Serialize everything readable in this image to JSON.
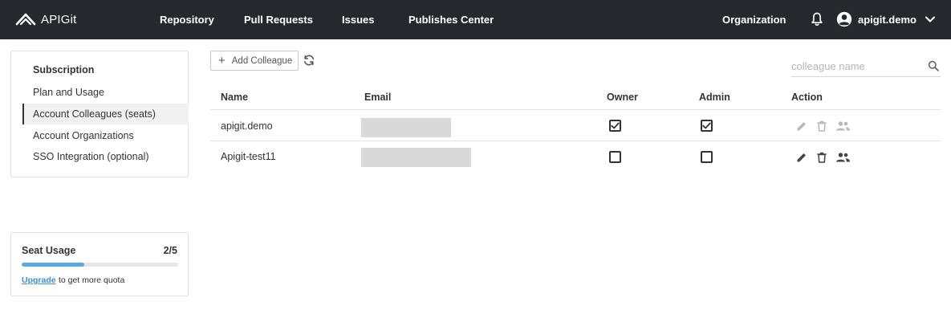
{
  "header": {
    "brand": "APIGit",
    "nav": [
      "Repository",
      "Pull Requests",
      "Issues",
      "Publishes Center"
    ],
    "org_link": "Organization",
    "user": "apigit.demo"
  },
  "sidebar": {
    "title": "Subscription",
    "items": [
      {
        "label": "Plan and Usage"
      },
      {
        "label": "Account Colleagues (seats)",
        "active": true
      },
      {
        "label": "Account Organizations"
      },
      {
        "label": "SSO Integration (optional)"
      }
    ]
  },
  "seat_usage": {
    "title": "Seat Usage",
    "count": "2/5",
    "used": 2,
    "total": 5,
    "upgrade_link": "Upgrade",
    "note": "to get more quota"
  },
  "toolbar": {
    "add_label": "Add Colleague",
    "search_placeholder": "colleague name"
  },
  "table": {
    "headers": {
      "name": "Name",
      "email": "Email",
      "owner": "Owner",
      "admin": "Admin",
      "action": "Action"
    },
    "rows": [
      {
        "name": "apigit.demo",
        "owner": true,
        "admin": true,
        "actions_enabled": false
      },
      {
        "name": "Apigit-test11",
        "owner": false,
        "admin": false,
        "actions_enabled": true
      }
    ]
  },
  "colors": {
    "topbar": "#25282d",
    "accent": "#5aa9e6",
    "link": "#3b8fd6",
    "icon_disabled": "#b8b8b8",
    "icon_active": "#444444"
  }
}
